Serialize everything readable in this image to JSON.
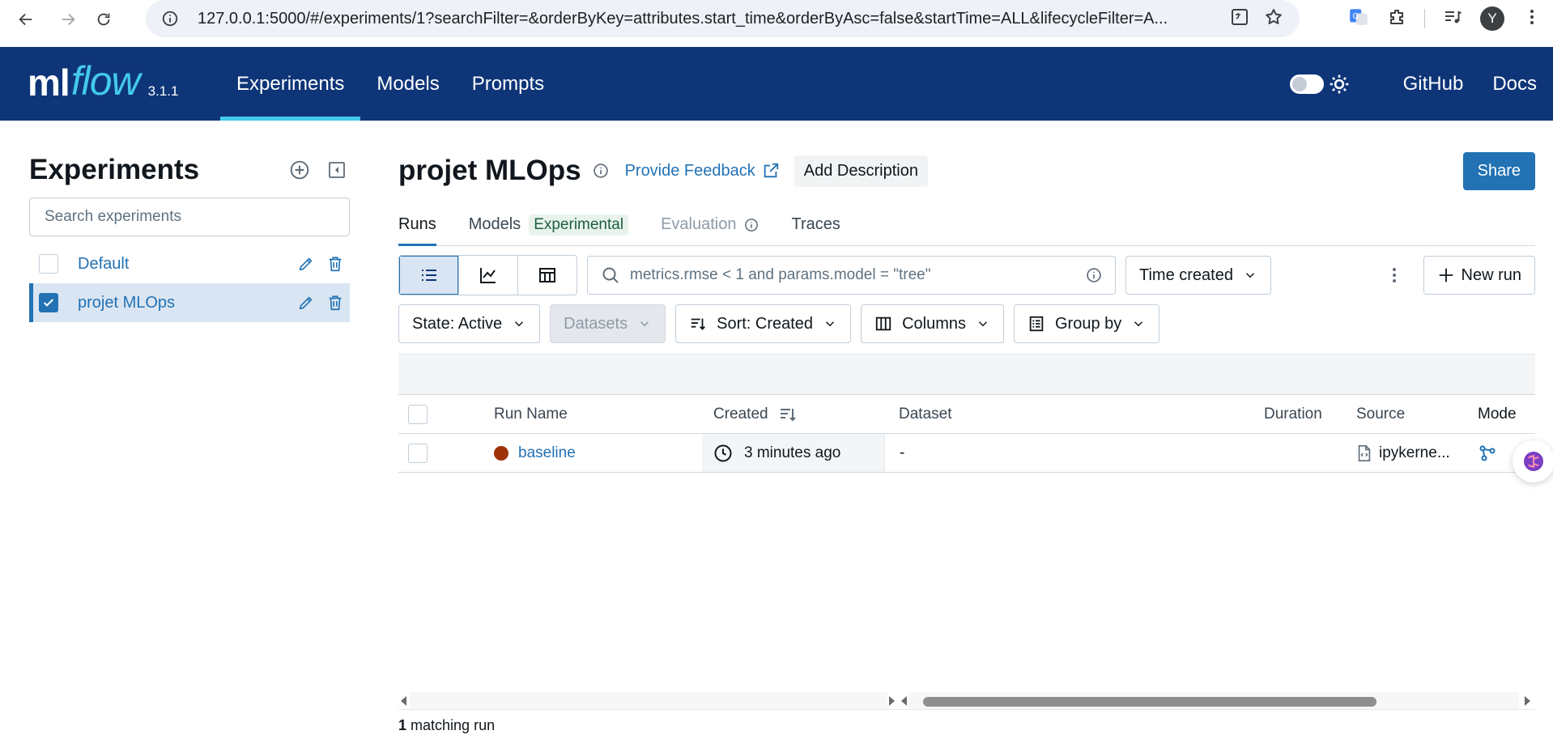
{
  "browser": {
    "url": "127.0.0.1:5000/#/experiments/1?searchFilter=&orderByKey=attributes.start_time&orderByAsc=false&startTime=ALL&lifecycleFilter=A...",
    "avatar_letter": "Y"
  },
  "header": {
    "logo_ml": "ml",
    "logo_flow": "flow",
    "version": "3.1.1",
    "nav": [
      {
        "label": "Experiments",
        "active": true
      },
      {
        "label": "Models",
        "active": false
      },
      {
        "label": "Prompts",
        "active": false
      }
    ],
    "github_label": "GitHub",
    "docs_label": "Docs"
  },
  "sidebar": {
    "title": "Experiments",
    "search_placeholder": "Search experiments",
    "items": [
      {
        "name": "Default",
        "checked": false
      },
      {
        "name": "projet MLOps",
        "checked": true
      }
    ]
  },
  "main": {
    "title": "projet MLOps",
    "feedback_label": "Provide Feedback",
    "add_description_label": "Add Description",
    "share_label": "Share",
    "tabs": [
      {
        "label": "Runs"
      },
      {
        "label": "Models",
        "badge": "Experimental"
      },
      {
        "label": "Evaluation"
      },
      {
        "label": "Traces"
      }
    ],
    "search_placeholder": "metrics.rmse < 1 and params.model = \"tree\"",
    "time_filter": "Time created",
    "new_run_label": "New run",
    "state_filter": "State: Active",
    "datasets_label": "Datasets",
    "sort_label": "Sort: Created",
    "columns_label": "Columns",
    "group_by_label": "Group by"
  },
  "table": {
    "columns": [
      "Run Name",
      "Created",
      "Dataset",
      "Duration",
      "Source",
      "Mode"
    ],
    "rows": [
      {
        "run_name": "baseline",
        "created": "3 minutes ago",
        "dataset": "-",
        "duration": "",
        "source": "ipykerne..."
      }
    ],
    "match_count": "1",
    "match_label": "matching run"
  },
  "colors": {
    "header_bg": "#0e3578",
    "accent": "#2272b4",
    "run_status_color": "#9e3209"
  }
}
